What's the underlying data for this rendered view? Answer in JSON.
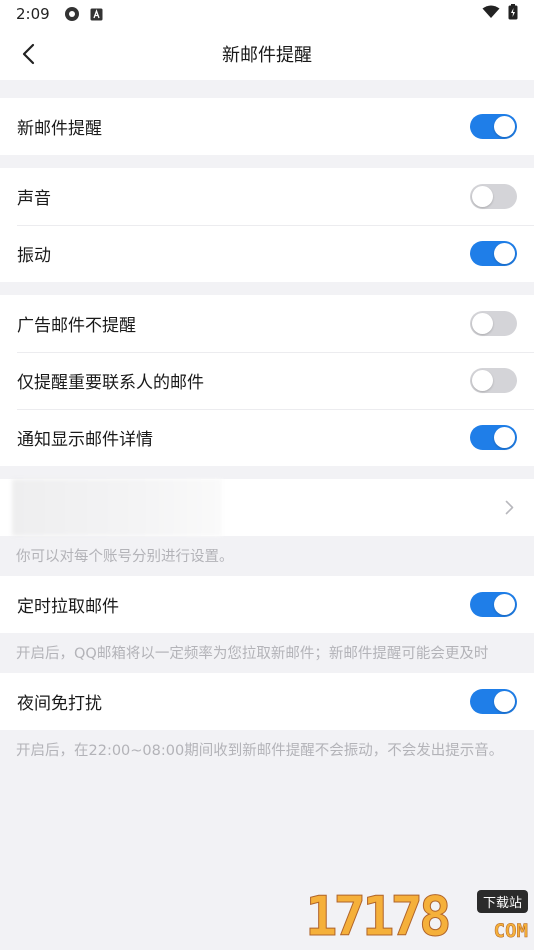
{
  "status_bar": {
    "time": "2:09"
  },
  "nav": {
    "title": "新邮件提醒"
  },
  "sections": {
    "main": {
      "label": "新邮件提醒",
      "on": true
    },
    "sound": {
      "label": "声音",
      "on": false
    },
    "vibrate": {
      "label": "振动",
      "on": true
    },
    "ads": {
      "label": "广告邮件不提醒",
      "on": false
    },
    "important": {
      "label": "仅提醒重要联系人的邮件",
      "on": false
    },
    "details": {
      "label": "通知显示邮件详情",
      "on": true
    }
  },
  "account_hint": "你可以对每个账号分别进行设置。",
  "fetch": {
    "label": "定时拉取邮件",
    "on": true,
    "hint": "开启后，QQ邮箱将以一定频率为您拉取新邮件；新邮件提醒可能会更及时"
  },
  "dnd": {
    "label": "夜间免打扰",
    "on": true,
    "hint": "开启后，在22:00~08:00期间收到新邮件提醒不会振动，不会发出提示音。"
  },
  "watermark": {
    "digits": "17178",
    "badge": "下载站",
    "suffix": "COM"
  },
  "colors": {
    "accent": "#1f7ee8",
    "toggle_off": "#d4d4d8",
    "background": "#f2f2f5"
  },
  "icons": [
    "back-chevron-icon",
    "chevron-right-icon",
    "wifi-icon",
    "battery-icon",
    "app-notification-icon",
    "a-box-icon"
  ]
}
